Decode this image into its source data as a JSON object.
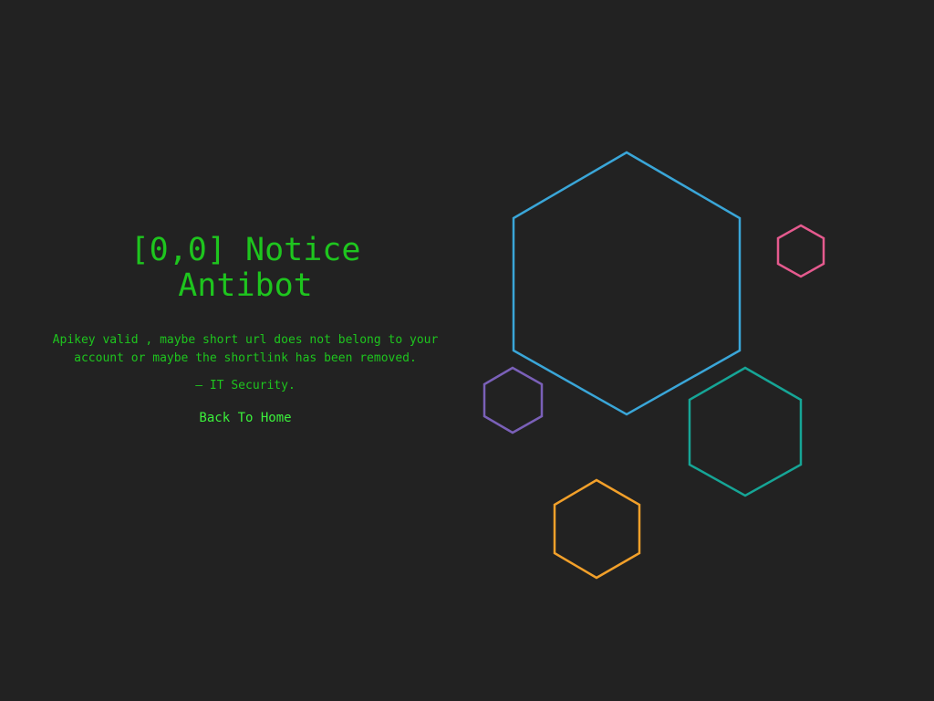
{
  "notice": {
    "title_line1": "[0,0] Notice",
    "title_line2": "Antibot",
    "message": "Apikey valid , maybe short url does not belong to your account or maybe the shortlink has been removed.",
    "signature": "— IT Security.",
    "back_link": "Back To Home"
  },
  "colors": {
    "background": "#222222",
    "text": "#1ec51e",
    "link": "#3bf03b",
    "hexagons": [
      "#3aa6d8",
      "#e55a8e",
      "#7a60b8",
      "#16a596",
      "#f2a02a"
    ]
  }
}
